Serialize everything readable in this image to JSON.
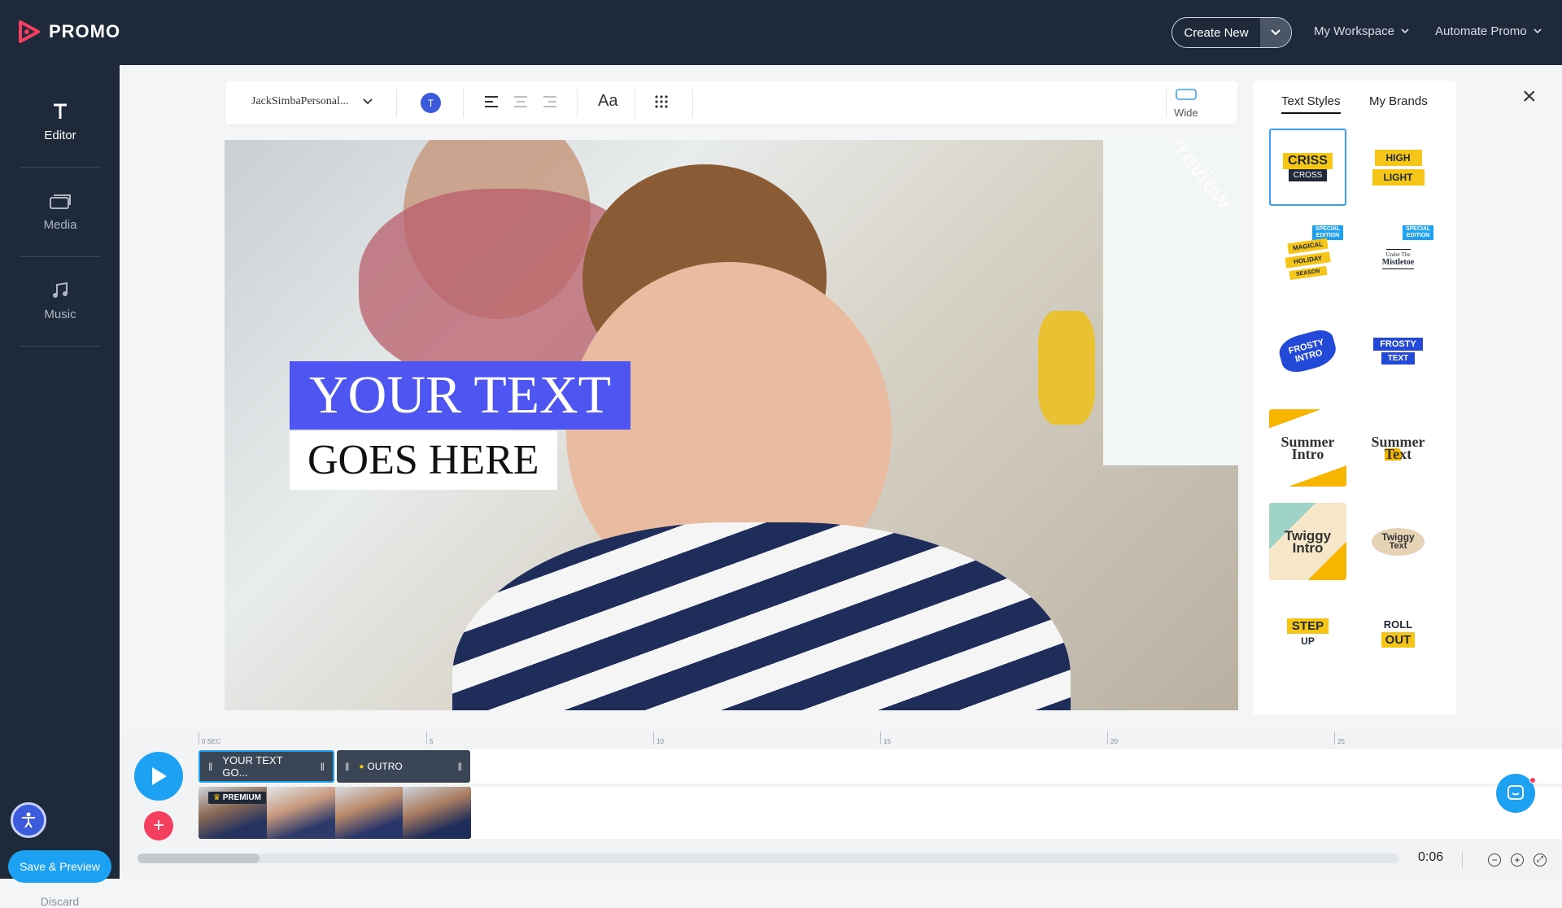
{
  "app": {
    "name": "PROMO"
  },
  "topbar": {
    "create_new": "Create New",
    "workspace": "My Workspace",
    "automate": "Automate Promo"
  },
  "sidebar": {
    "items": [
      {
        "label": "Editor",
        "icon": "text-icon"
      },
      {
        "label": "Media",
        "icon": "media-icon"
      },
      {
        "label": "Music",
        "icon": "music-icon"
      }
    ],
    "save_preview": "Save & Preview",
    "discard": "Discard"
  },
  "toolbar": {
    "font": "JackSimbaPersonal...",
    "color_letter": "T",
    "text_size_label": "Aa",
    "layout_label": "Wide"
  },
  "preview": {
    "watermark": "Preview",
    "line1": "YOUR TEXT",
    "line2": "GOES HERE"
  },
  "panel": {
    "tabs": [
      "Text Styles",
      "My Brands"
    ],
    "styles": [
      {
        "lines": [
          "CRISS",
          "CROSS"
        ]
      },
      {
        "lines": [
          "HIGH",
          "LIGHT"
        ]
      },
      {
        "lines": [
          "MAGICAL",
          "HOLIDAY",
          "SEASON"
        ],
        "badge": "SPECIAL EDITION"
      },
      {
        "lines": [
          "Under The",
          "Mistletoe"
        ],
        "badge": "SPECIAL EDITION"
      },
      {
        "lines": [
          "FROSTY",
          "INTRO"
        ]
      },
      {
        "lines": [
          "FROSTY",
          "TEXT"
        ]
      },
      {
        "lines": [
          "Summer",
          "Intro"
        ]
      },
      {
        "lines": [
          "Summer",
          "Text"
        ]
      },
      {
        "lines": [
          "Twiggy",
          "Intro"
        ]
      },
      {
        "lines": [
          "Twiggy",
          "Text"
        ]
      },
      {
        "lines": [
          "STEP",
          "UP"
        ]
      },
      {
        "lines": [
          "ROLL",
          "OUT"
        ]
      }
    ]
  },
  "timeline": {
    "ticks": [
      "0 SEC",
      "5",
      "10",
      "15",
      "20",
      "25"
    ],
    "text_clip": "YOUR TEXT GO...",
    "outro_clip": "OUTRO",
    "premium": "PREMIUM",
    "time": "0:06"
  },
  "colors": {
    "brand_dark": "#1e2a3a",
    "accent_blue": "#1da1f2",
    "text_box_purple": "#4f55f0",
    "add_red": "#f43f5e",
    "style_yellow": "#f5c518"
  }
}
